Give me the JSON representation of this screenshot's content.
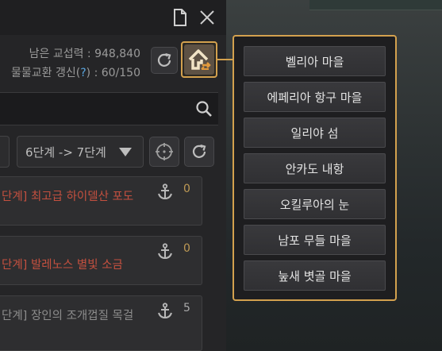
{
  "header": {
    "document_icon": "document-icon",
    "close_icon": "close-icon"
  },
  "stats": {
    "energy_label": "남은 교섭력 : 948,840",
    "barter_prefix": "물물교환 갱신(",
    "barter_help": "?",
    "barter_suffix": ") : 60/150"
  },
  "search": {
    "icon": "search-icon"
  },
  "filter": {
    "stage_value": "6단계 -> 7단계",
    "locate_icon": "crosshair-icon",
    "refresh_icon": "refresh-icon"
  },
  "items": [
    {
      "title": "단계] 최고급 하이델산 포도",
      "count": "0",
      "title_color": "#c4503f",
      "count_color": "#bf9a55"
    },
    {
      "title": "단계] 발레노스 별빛 소금",
      "count": "0",
      "title_color": "#c4503f",
      "count_color": "#bf9a55"
    },
    {
      "title": "단계] 장인의 조개껍질 목걸",
      "count": "5",
      "title_color": "#8d8d8d",
      "count_color": "#a9a9a9"
    }
  ],
  "dropdown": {
    "items": [
      "벨리아 마을",
      "에페리아 항구 마을",
      "일리야 섬",
      "안카도 내항",
      "오킬루아의 눈",
      "남포 무들 마을",
      "눞새 볏골 마을"
    ]
  },
  "colors": {
    "accent": "#d3a14e",
    "danger": "#c4503f",
    "link": "#5aa6e0"
  }
}
